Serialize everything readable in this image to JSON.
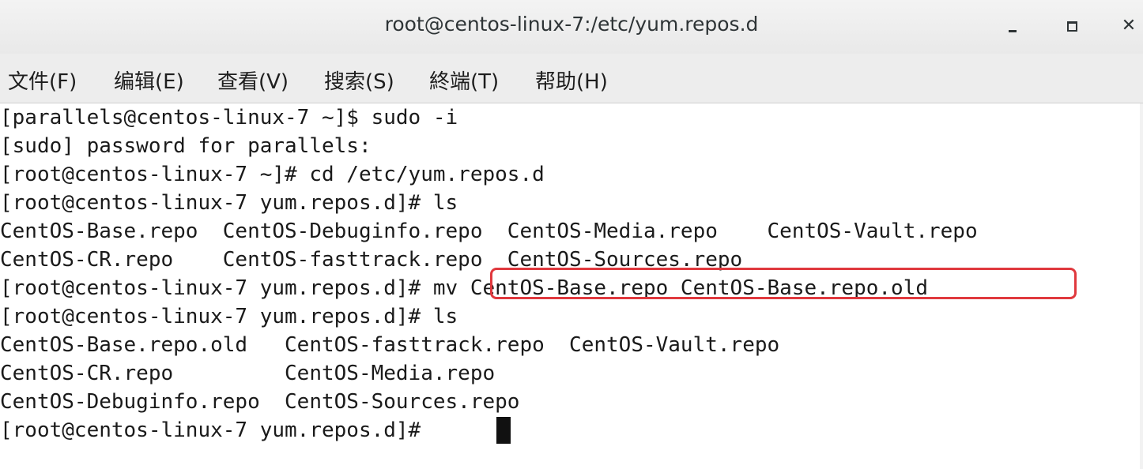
{
  "window": {
    "title": "root@centos-linux-7:/etc/yum.repos.d",
    "minimize_icon": "minimize-icon",
    "maximize_icon": "maximize-icon",
    "close_icon": "close-icon"
  },
  "menu": {
    "items": [
      {
        "label": "文件(F)"
      },
      {
        "label": "编辑(E)"
      },
      {
        "label": "查看(V)"
      },
      {
        "label": "搜索(S)"
      },
      {
        "label": "終端(T)"
      },
      {
        "label": "帮助(H)"
      }
    ]
  },
  "terminal": {
    "lines": [
      "[parallels@centos-linux-7 ~]$ sudo -i",
      "[sudo] password for parallels:",
      "[root@centos-linux-7 ~]# cd /etc/yum.repos.d",
      "[root@centos-linux-7 yum.repos.d]# ls",
      "CentOS-Base.repo  CentOS-Debuginfo.repo  CentOS-Media.repo    CentOS-Vault.repo",
      "CentOS-CR.repo    CentOS-fasttrack.repo  CentOS-Sources.repo",
      "[root@centos-linux-7 yum.repos.d]# mv CentOS-Base.repo CentOS-Base.repo.old",
      "[root@centos-linux-7 yum.repos.d]# ls",
      "CentOS-Base.repo.old   CentOS-fasttrack.repo  CentOS-Vault.repo",
      "CentOS-CR.repo         CentOS-Media.repo",
      "CentOS-Debuginfo.repo  CentOS-Sources.repo",
      "[root@centos-linux-7 yum.repos.d]# "
    ],
    "highlight_color": "#e0393e"
  }
}
